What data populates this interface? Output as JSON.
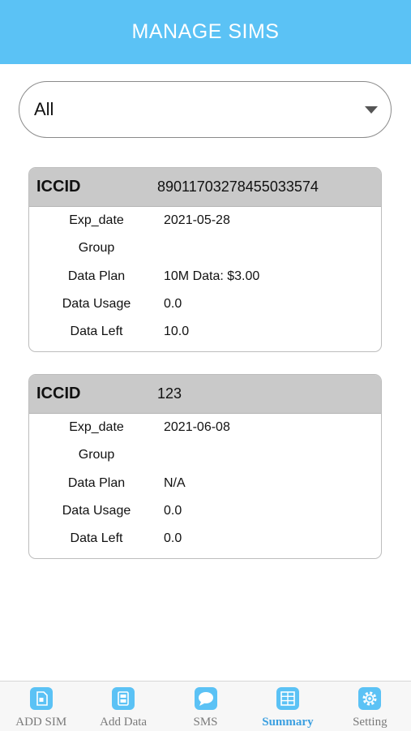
{
  "header": {
    "title": "MANAGE SIMS"
  },
  "filter": {
    "value": "All"
  },
  "cards": [
    {
      "key_label": "ICCID",
      "iccid": "89011703278455033574",
      "rows": [
        {
          "label": "Exp_date",
          "value": "2021-05-28"
        },
        {
          "label": "Group",
          "value": ""
        },
        {
          "label": "Data Plan",
          "value": "10M Data: $3.00"
        },
        {
          "label": "Data Usage",
          "value": "0.0"
        },
        {
          "label": "Data Left",
          "value": "10.0"
        }
      ]
    },
    {
      "key_label": "ICCID",
      "iccid": "123",
      "rows": [
        {
          "label": "Exp_date",
          "value": "2021-06-08"
        },
        {
          "label": "Group",
          "value": ""
        },
        {
          "label": "Data Plan",
          "value": "N/A"
        },
        {
          "label": "Data Usage",
          "value": "0.0"
        },
        {
          "label": "Data Left",
          "value": "0.0"
        }
      ]
    }
  ],
  "tabs": [
    {
      "label": "ADD SIM",
      "icon": "sim-card-icon"
    },
    {
      "label": "Add Data",
      "icon": "add-data-icon"
    },
    {
      "label": "SMS",
      "icon": "chat-bubble-icon"
    },
    {
      "label": "Summary",
      "icon": "summary-grid-icon",
      "active": true
    },
    {
      "label": "Setting",
      "icon": "gear-icon"
    }
  ],
  "colors": {
    "accent": "#5bc2f5",
    "active_tab": "#3b9fe0",
    "card_header": "#c9c9c9"
  }
}
